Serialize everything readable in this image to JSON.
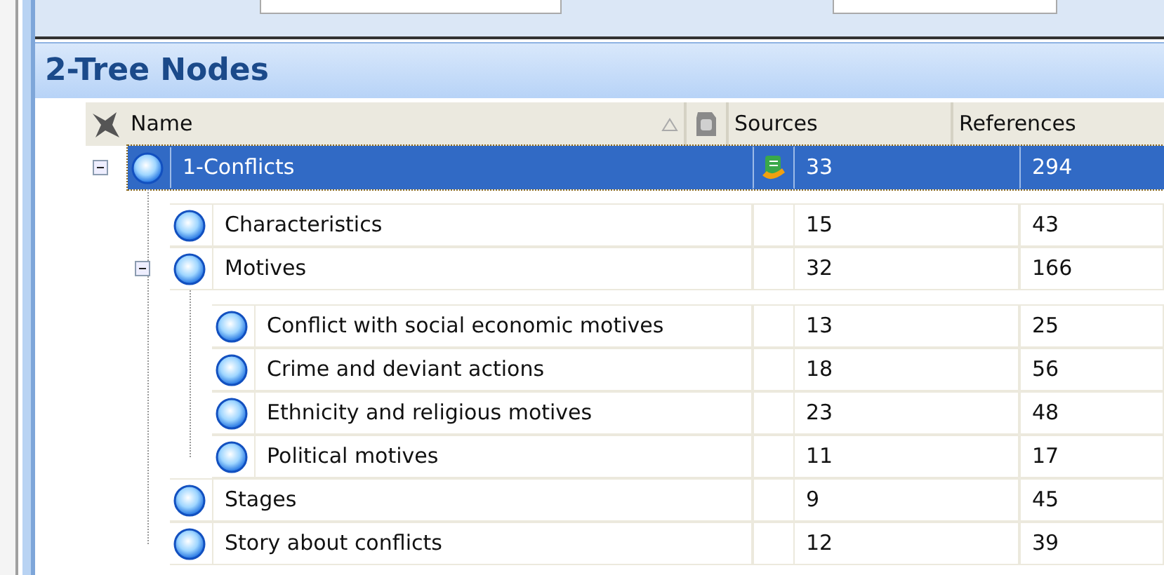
{
  "panel_title": "2-Tree Nodes",
  "columns": [
    {
      "label": "Name",
      "sorted": true
    },
    {
      "label": "Sources",
      "sorted": false
    },
    {
      "label": "References",
      "sorted": false
    }
  ],
  "nodes": [
    {
      "name": "1-Conflicts",
      "sources": "33",
      "references": "294",
      "selected": true,
      "indicator": true,
      "expanded": true,
      "children": [
        {
          "name": "Characteristics",
          "sources": "15",
          "references": "43",
          "selected": false,
          "indicator": false
        },
        {
          "name": "Motives",
          "sources": "32",
          "references": "166",
          "selected": false,
          "indicator": false,
          "expanded": true,
          "children": [
            {
              "name": "Conflict with social economic motives",
              "sources": "13",
              "references": "25",
              "selected": false,
              "indicator": false
            },
            {
              "name": "Crime and deviant actions",
              "sources": "18",
              "references": "56",
              "selected": false,
              "indicator": false
            },
            {
              "name": "Ethnicity and religious motives",
              "sources": "23",
              "references": "48",
              "selected": false,
              "indicator": false
            },
            {
              "name": "Political motives",
              "sources": "11",
              "references": "17",
              "selected": false,
              "indicator": false
            }
          ]
        },
        {
          "name": "Stages",
          "sources": "9",
          "references": "45",
          "selected": false,
          "indicator": false
        },
        {
          "name": "Story about conflicts",
          "sources": "12",
          "references": "39",
          "selected": false,
          "indicator": false
        }
      ]
    }
  ]
}
